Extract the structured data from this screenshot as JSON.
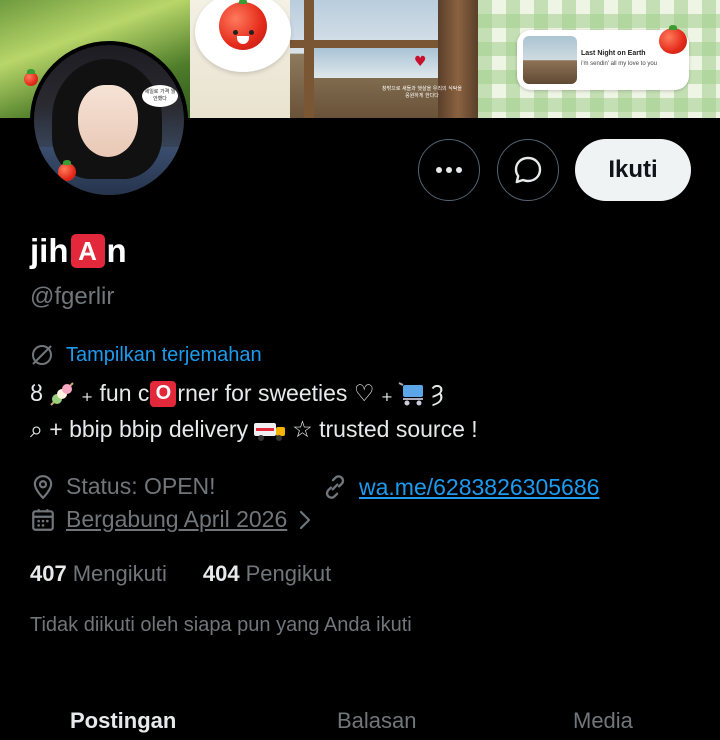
{
  "profile": {
    "name_start": "jih",
    "name_badge": "A",
    "name_end": "n",
    "handle": "@fgerlir",
    "translate_label": "Tampilkan terjemahan",
    "bio_line1": {
      "prefix": "ȣ",
      "part2": "₊ fun c",
      "badge": "O",
      "part3": "rner for sweeties ♡ ₊",
      "suffix": "Ȝ"
    },
    "bio_line2": {
      "part1": "⌕ + bbip bbip delivery",
      "part2": "☆ trusted source !"
    },
    "status": "Status: OPEN!",
    "link": "wa.me/6283826305686",
    "joined": "Bergabung April 2026",
    "following_count": "407",
    "following_label": "Mengikuti",
    "followers_count": "404",
    "followers_label": "Pengikut",
    "followed_by_note": "Tidak diikuti oleh siapa pun yang Anda ikuti"
  },
  "actions": {
    "more_icon": "more-horizontal-icon",
    "message_icon": "message-bubble-icon",
    "follow_label": "Ikuti"
  },
  "banner": {
    "caption": "창밖으로 새들과 햇살을 우리의 식탁을 응원하게 한다다",
    "music_title": "Last Night on Earth",
    "music_subtitle": "i'm sendin' all my love to you"
  },
  "avatar": {
    "bubble_text": "세일로 가격 뭘 안했다"
  },
  "tabs": [
    {
      "label": "Postingan",
      "active": true
    },
    {
      "label": "Balasan",
      "active": false
    },
    {
      "label": "Media",
      "active": false
    }
  ],
  "colors": {
    "accent": "#1d9bf0",
    "badge_red": "#e3283c",
    "muted": "#71767b"
  }
}
